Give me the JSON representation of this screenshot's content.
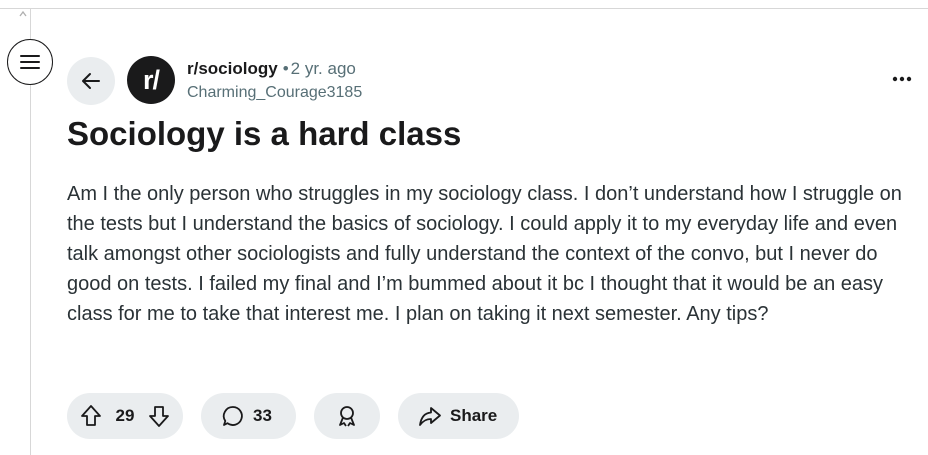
{
  "post": {
    "subreddit": "r/sociology",
    "separator": "•",
    "time_ago": "2 yr. ago",
    "author": "Charming_Courage3185",
    "avatar_text": "r/",
    "title": "Sociology is a hard class",
    "body": "Am I the only person who struggles in my sociology class. I don’t understand how I struggle on the tests but I understand the basics of sociology. I could apply it to my everyday life and even talk amongst other sociologists and fully understand the context of the convo, but I never do good on tests. I failed my final and I’m bummed about it bc I thought that it would be an easy class for me to take that interest me. I plan on taking it next semester. Any tips?"
  },
  "actions": {
    "score": "29",
    "comments": "33",
    "share_label": "Share"
  },
  "icons": {
    "menu": "hamburger-menu-icon",
    "back": "arrow-left-icon",
    "more": "ellipsis-icon",
    "upvote": "arrow-up-outline-icon",
    "downvote": "arrow-down-outline-icon",
    "comment": "speech-bubble-icon",
    "award": "award-ribbon-icon",
    "share": "share-arrow-icon"
  },
  "colors": {
    "pill_background": "#eaedef",
    "avatar_background": "#1a1a1b",
    "meta_gray": "#576f76"
  }
}
